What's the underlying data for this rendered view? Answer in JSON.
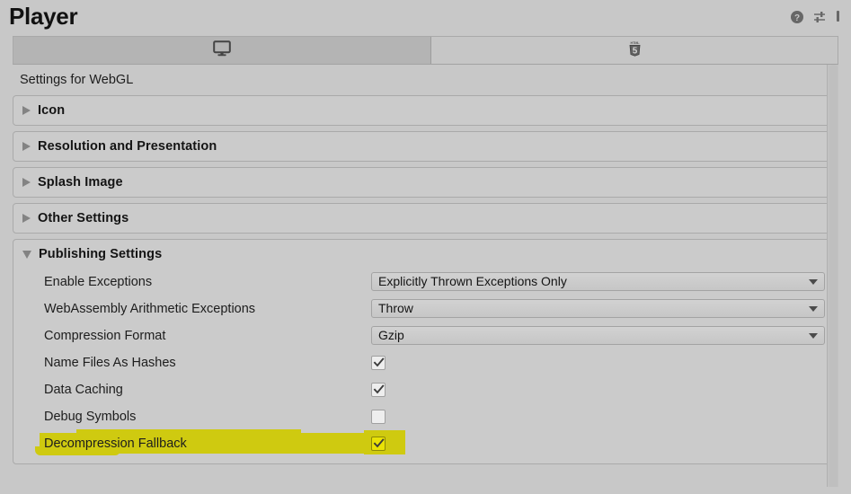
{
  "header": {
    "title": "Player",
    "icons": [
      {
        "name": "help-icon",
        "label": "Help"
      },
      {
        "name": "preset-icon",
        "label": "Preset"
      },
      {
        "name": "more-menu-icon",
        "label": "More"
      }
    ]
  },
  "tabs": [
    {
      "name": "tab-standalone",
      "icon": "desktop-monitor-icon",
      "selected": true
    },
    {
      "name": "tab-webgl",
      "icon": "html5-icon",
      "selected": false
    }
  ],
  "panel": {
    "settings_for": "Settings for WebGL"
  },
  "sections": [
    {
      "title": "Icon",
      "expanded": false
    },
    {
      "title": "Resolution and Presentation",
      "expanded": false
    },
    {
      "title": "Splash Image",
      "expanded": false
    },
    {
      "title": "Other Settings",
      "expanded": false
    },
    {
      "title": "Publishing Settings",
      "expanded": true
    }
  ],
  "publishing_settings": {
    "rows": [
      {
        "label": "Enable Exceptions",
        "type": "dropdown",
        "value": "Explicitly Thrown Exceptions Only",
        "name": "enable-exceptions-dropdown"
      },
      {
        "label": "WebAssembly Arithmetic Exceptions",
        "type": "dropdown",
        "value": "Throw",
        "name": "webassembly-arithmetic-exceptions-dropdown"
      },
      {
        "label": "Compression Format",
        "type": "dropdown",
        "value": "Gzip",
        "name": "compression-format-dropdown"
      },
      {
        "label": "Name Files As Hashes",
        "type": "checkbox",
        "checked": true,
        "highlighted": false,
        "name": "name-files-as-hashes-checkbox"
      },
      {
        "label": "Data Caching",
        "type": "checkbox",
        "checked": true,
        "highlighted": false,
        "name": "data-caching-checkbox"
      },
      {
        "label": "Debug Symbols",
        "type": "checkbox",
        "checked": false,
        "highlighted": false,
        "name": "debug-symbols-checkbox"
      },
      {
        "label": "Decompression Fallback",
        "type": "checkbox",
        "checked": true,
        "highlighted": true,
        "name": "decompression-fallback-checkbox"
      }
    ]
  },
  "colors": {
    "background": "#c8c8c8",
    "section_background": "#cbcbcb",
    "section_border": "#aaaaaa",
    "highlight_marker": "#cfca10",
    "highlight_checkbox": "#e9e206",
    "text": "#1d1d1d"
  }
}
